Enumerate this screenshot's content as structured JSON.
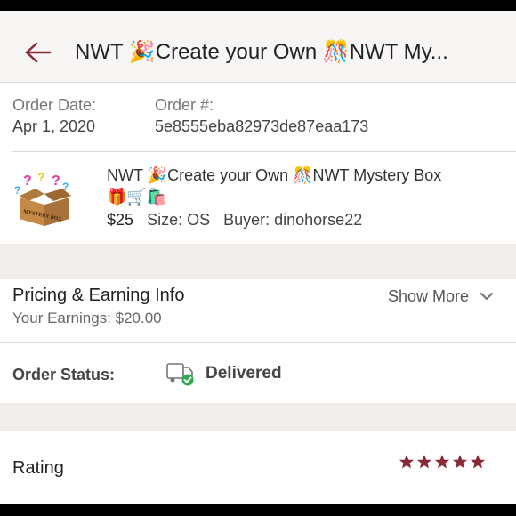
{
  "header": {
    "title": "NWT 🎉Create your Own 🎊NWT My...",
    "accent_color": "#8b2a37"
  },
  "order": {
    "date_label": "Order Date:",
    "date_value": "Apr 1, 2020",
    "number_label": "Order #:",
    "number_value": "5e8555eba82973de87eaa173"
  },
  "product": {
    "thumbnail_text": "MYSTERY BOX",
    "title": "NWT 🎉Create your Own 🎊NWT Mystery Box",
    "emojis": "🎁🛒🛍️",
    "price": "$25",
    "size": "Size: OS",
    "buyer": "Buyer: dinohorse22"
  },
  "pricing": {
    "title": "Pricing & Earning Info",
    "earnings": "Your Earnings: $20.00",
    "show_more_label": "Show More"
  },
  "status": {
    "label": "Order Status:",
    "value": "Delivered",
    "icon": "delivered-truck-check-icon",
    "check_color": "#2daa4f"
  },
  "rating": {
    "label": "Rating",
    "stars": 5,
    "star_color": "#8b2a37"
  }
}
